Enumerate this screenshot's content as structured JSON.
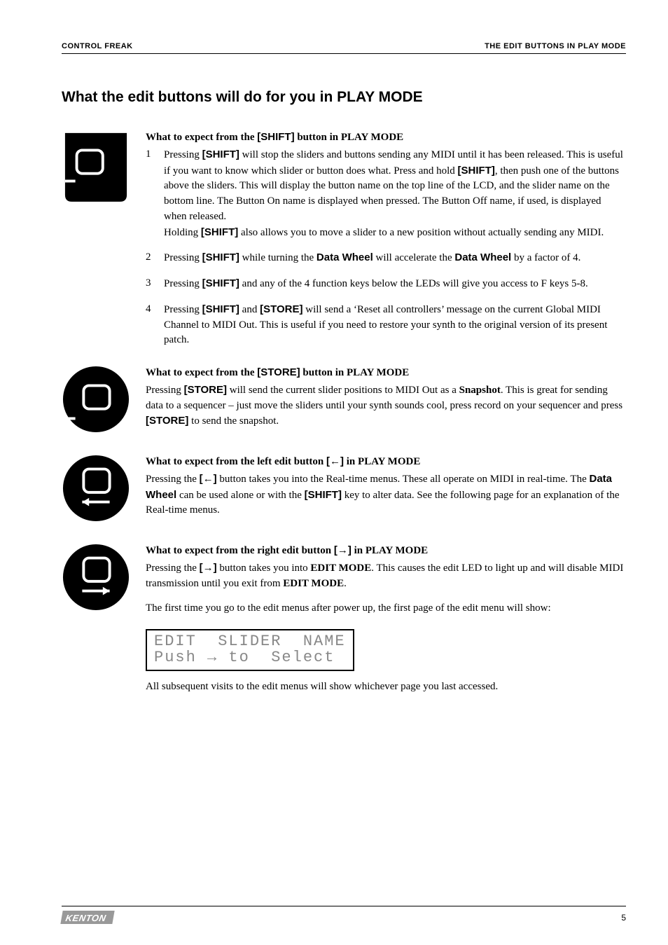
{
  "header": {
    "left": "CONTROL FREAK",
    "right": "THE EDIT BUTTONS IN PLAY MODE"
  },
  "main_heading": "What the edit buttons will do for you in PLAY MODE",
  "sections": {
    "shift": {
      "heading_pre": "What to expect from the ",
      "heading_btn": "[SHIFT]",
      "heading_post": " button in PLAY MODE",
      "items": {
        "n1": {
          "num": "1",
          "t1": "Pressing ",
          "b1": "[SHIFT]",
          "t2": " will stop the sliders and buttons sending any MIDI until it has been released. This is useful if you want to know which slider or button does what. Press and hold ",
          "b2": "[SHIFT]",
          "t3": ", then push one of the buttons above the sliders. This will display the button name on the top line of the LCD, and the slider name on the bottom line. The Button On name is displayed when pressed. The Button Off name, if used, is displayed when released.",
          "t4": "Holding ",
          "b3": "[SHIFT]",
          "t5": " also allows you to move a slider to a new position without actually sending any MIDI."
        },
        "n2": {
          "num": "2",
          "t1": "Pressing ",
          "b1": "[SHIFT]",
          "t2": " while turning the ",
          "b2": "Data Wheel",
          "t3": " will accelerate the ",
          "b3": "Data Wheel",
          "t4": " by a factor of 4."
        },
        "n3": {
          "num": "3",
          "t1": "Pressing ",
          "b1": "[SHIFT]",
          "t2": " and any of the 4 function keys below the LEDs will give you access to F keys 5-8."
        },
        "n4": {
          "num": "4",
          "t1": "Pressing ",
          "b1": "[SHIFT]",
          "t2": " and ",
          "b2": "[STORE]",
          "t3": " will send a ‘Reset all controllers’ message on the current Global MIDI Channel to MIDI Out. This is useful if you need to restore your synth to the original version of its present patch."
        }
      }
    },
    "store": {
      "heading_pre": "What to expect from the ",
      "heading_btn": "[STORE]",
      "heading_post": " button in PLAY MODE",
      "t1": "Pressing ",
      "b1": "[STORE]",
      "t2": " will send the current slider positions to MIDI Out as a ",
      "b2": "Snapshot",
      "t3": ". This is great for sending data to a sequencer – just move the sliders until your synth sounds cool, press record on your sequencer and press ",
      "b3": "[STORE]",
      "t4": " to send the snapshot."
    },
    "left": {
      "heading_pre": "What to expect from the left edit button ",
      "heading_btn": "[←]",
      "heading_post": " in PLAY MODE",
      "t1": "Pressing the ",
      "b1": "[←]",
      "t2": " button takes you into the Real-time menus. These all operate on MIDI in real-time. The ",
      "b2": "Data Wheel",
      "t3": " can be used alone or with the ",
      "b3": "[SHIFT]",
      "t4": " key to alter data. See the following page for an explanation of the Real-time menus."
    },
    "right": {
      "heading_pre": "What to expect from the right edit button ",
      "heading_btn": "[→]",
      "heading_post": " in PLAY MODE",
      "t1": "Pressing the ",
      "b1": "[→]",
      "t2": " button takes you into ",
      "b2": "EDIT MODE",
      "t3": ".  This causes the edit LED to light up and will disable MIDI transmission until you exit from ",
      "b3": "EDIT MODE",
      "t4": ".",
      "intro2": "The first time you go to the edit menus after power up, the first page of the edit menu will show:",
      "lcd_line1": "EDIT  SLIDER  NAME",
      "lcd_line2": "Push → to  Select",
      "outro": "All subsequent visits to the edit menus will show whichever page you last accessed."
    }
  },
  "footer": {
    "logo": "KENTON",
    "page": "5"
  }
}
